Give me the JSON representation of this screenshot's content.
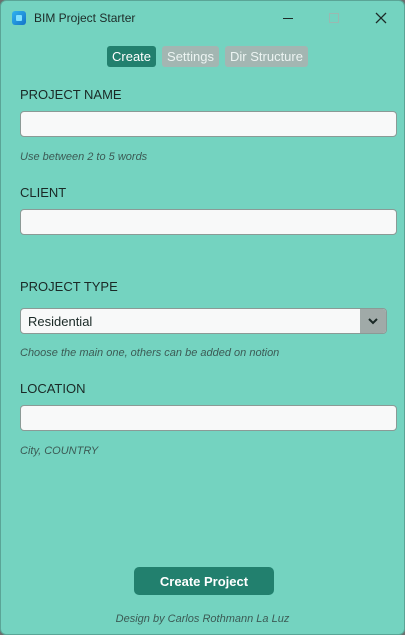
{
  "window": {
    "title": "BIM Project Starter",
    "icons": {
      "app": "app-icon",
      "minimize": "minimize-icon",
      "maximize": "maximize-icon",
      "close": "close-icon"
    }
  },
  "tabs": [
    {
      "label": "Create",
      "active": true
    },
    {
      "label": "Settings",
      "active": false
    },
    {
      "label": "Dir Structure",
      "active": false
    }
  ],
  "form": {
    "project_name": {
      "label": "PROJECT NAME",
      "value": "",
      "hint": "Use between 2 to 5 words"
    },
    "client": {
      "label": "CLIENT",
      "value": ""
    },
    "project_type": {
      "label": "PROJECT TYPE",
      "selected": "Residential",
      "hint": "Choose the main one, others can be added on notion",
      "arrow_icon": "chevron-down-icon"
    },
    "location": {
      "label": "LOCATION",
      "value": "",
      "hint": "City, COUNTRY"
    }
  },
  "actions": {
    "create_label": "Create Project"
  },
  "footer": {
    "credit": "Design by Carlos Rothmann La Luz"
  },
  "colors": {
    "background": "#74d3c0",
    "accent": "#22806e",
    "inactive_tab": "#a3b6b2",
    "field_bg": "#f8f9f9"
  }
}
